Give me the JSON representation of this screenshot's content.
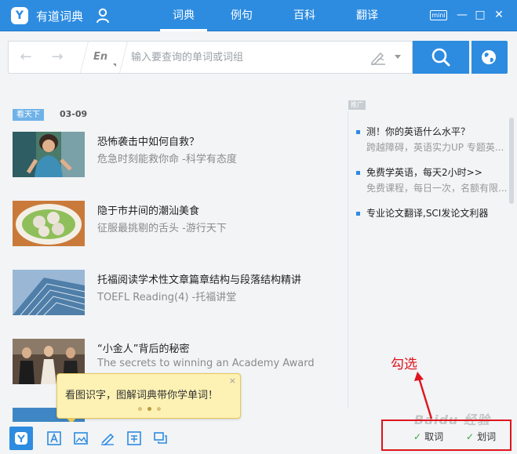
{
  "app": {
    "title": "有道词典"
  },
  "nav": {
    "tabs": [
      "词典",
      "例句",
      "百科",
      "翻译"
    ],
    "active": 0
  },
  "window": {
    "mini_label": "mini",
    "min_glyph": "—",
    "max_glyph": "□",
    "close_glyph": "✕"
  },
  "search": {
    "lang": "En",
    "placeholder": "输入要查询的单词或词组",
    "value": ""
  },
  "feed": {
    "badge": "看天下",
    "date": "03-09",
    "items": [
      {
        "title": "恐怖袭击中如何自救？",
        "subtitle": "危急时刻能救你命 -科学有态度",
        "thumb": "woman-photo"
      },
      {
        "title": "隐于市井间的潮汕美食",
        "subtitle": "征服最挑剔的舌头 -游行天下",
        "thumb": "meatball-soup-photo"
      },
      {
        "title": "托福阅读学术性文章篇章结构与段落结构精讲",
        "subtitle": "TOEFL Reading(4) -托福讲堂",
        "thumb": "building-photo"
      },
      {
        "title": "“小金人”背后的秘密",
        "subtitle": "The secrets to winning an Academy Award",
        "thumb": "awards-photo"
      }
    ]
  },
  "ads": {
    "tag": "推广",
    "items": [
      {
        "title": "测！你的英语什么水平？",
        "subtitle": "跨越障碍，英语实力UP 专题英..."
      },
      {
        "title": "免费学英语，每天2小时>>",
        "subtitle": "免费课程，每日一次，名额有限..."
      },
      {
        "title": "专业论文翻译,SCI发论文利器",
        "subtitle": ""
      }
    ]
  },
  "tooltip": {
    "text": "看图识字，图解词典带你学单词！",
    "close": "×"
  },
  "annotation": {
    "text": "勾选"
  },
  "bottom": {
    "checks": [
      {
        "label": "取词",
        "checked": true
      },
      {
        "label": "划词",
        "checked": true
      }
    ],
    "watermark": "Baidu 经验"
  },
  "colors": {
    "brand": "#2d8ce0",
    "annotation": "#e0141e",
    "tooltip_bg": "#fdf2b4"
  }
}
